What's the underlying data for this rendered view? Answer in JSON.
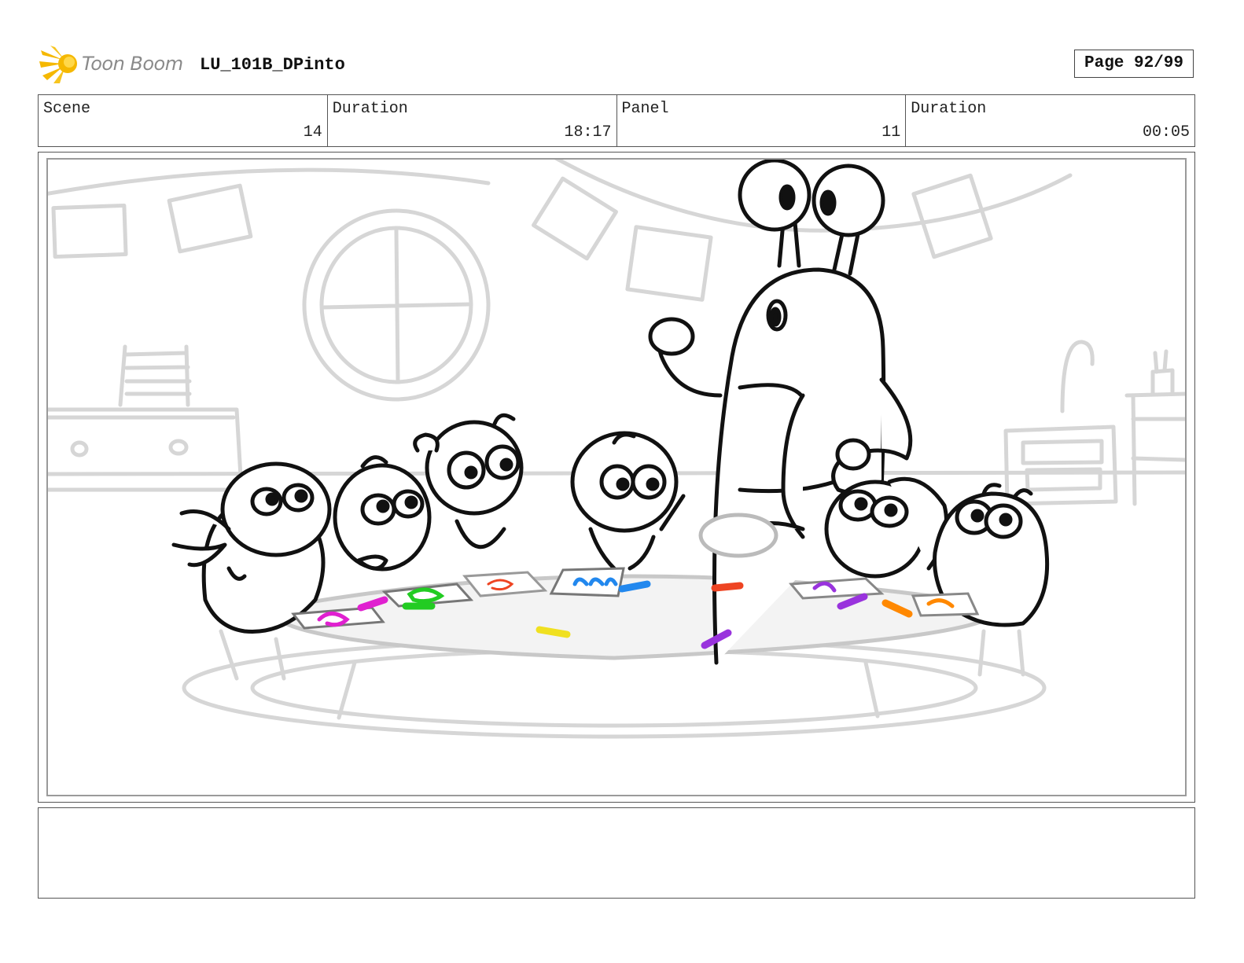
{
  "header": {
    "logo_text": "Toon Boom",
    "logo_icon": "starburst-logo-icon",
    "project": "LU_101B_DPinto",
    "page": "Page 92/99"
  },
  "info": {
    "scene_label": "Scene",
    "scene_value": "14",
    "scene_duration_label": "Duration",
    "scene_duration_value": "18:17",
    "panel_label": "Panel",
    "panel_value": "11",
    "panel_duration_label": "Duration",
    "panel_duration_value": "00:05"
  },
  "colors": {
    "logo_yellow": "#f5b800",
    "sketch_line": "#111111",
    "background_sketch": "#d9d9d9",
    "crayon_magenta": "#e020d0",
    "crayon_green": "#22cc22",
    "crayon_red": "#ee4422",
    "crayon_blue": "#2288ee",
    "crayon_yellow": "#f0e020",
    "crayon_purple": "#9933dd",
    "crayon_orange": "#ff8800"
  }
}
